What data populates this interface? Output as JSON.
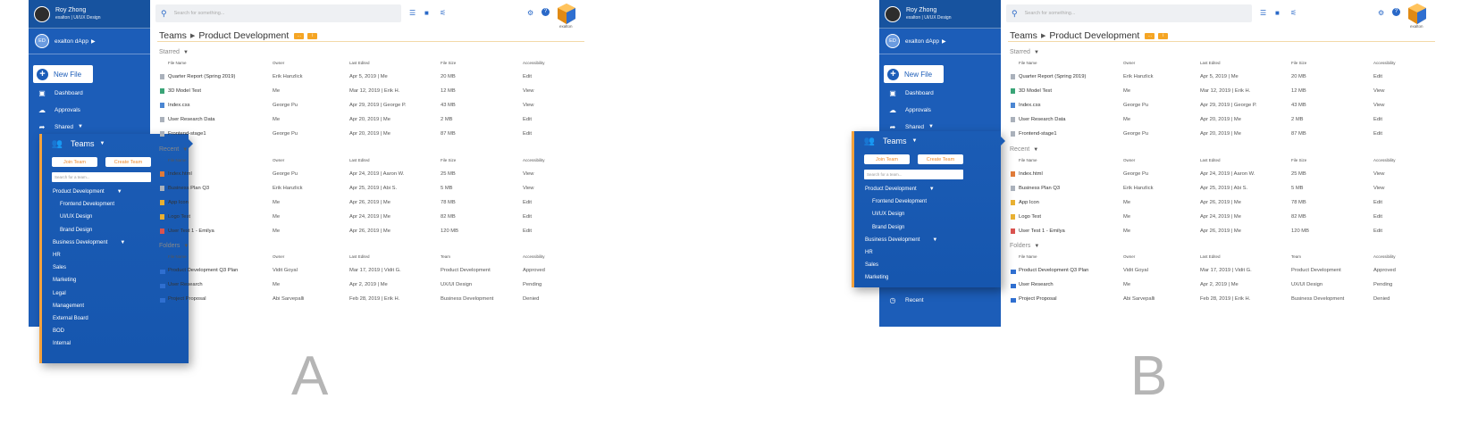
{
  "user": {
    "name": "Roy Zhong",
    "role": "exalton | UI/UX Design"
  },
  "org": {
    "initials": "ED",
    "name": "exalton dApp"
  },
  "new_file_label": "New File",
  "nav": [
    {
      "label": "Dashboard",
      "icon": "dashboard-icon"
    },
    {
      "label": "Approvals",
      "icon": "cloud-check-icon"
    },
    {
      "label": "Shared",
      "icon": "share-icon"
    }
  ],
  "recent_nav_label": "Recent",
  "search": {
    "placeholder": "Search for something..."
  },
  "logo_text": "exalton",
  "breadcrumb": {
    "root": "Teams",
    "current": "Product Development"
  },
  "teams_panel": {
    "title": "Teams",
    "join_label": "Join Team",
    "create_label": "Create Team",
    "search_placeholder": "Search for a team...",
    "items_a": [
      {
        "label": "Product Development",
        "level": 0,
        "dropdown": true
      },
      {
        "label": "Frontend Development",
        "level": 1
      },
      {
        "label": "UI/UX Design",
        "level": 1
      },
      {
        "label": "Brand Design",
        "level": 1
      },
      {
        "label": "Business Development",
        "level": 0,
        "dropdown": true
      },
      {
        "label": "HR",
        "level": 0
      },
      {
        "label": "Sales",
        "level": 0
      },
      {
        "label": "Marketing",
        "level": 0
      },
      {
        "label": "Legal",
        "level": 0
      },
      {
        "label": "Management",
        "level": 0
      },
      {
        "label": "External Board",
        "level": 0
      },
      {
        "label": "BOD",
        "level": 0
      },
      {
        "label": "Internal",
        "level": 0
      }
    ],
    "items_b": [
      {
        "label": "Product Development",
        "level": 0,
        "dropdown": true
      },
      {
        "label": "Frontend Development",
        "level": 1
      },
      {
        "label": "UI/UX Design",
        "level": 1
      },
      {
        "label": "Brand Design",
        "level": 1
      },
      {
        "label": "Business Development",
        "level": 0,
        "dropdown": true
      },
      {
        "label": "HR",
        "level": 0
      },
      {
        "label": "Sales",
        "level": 0
      },
      {
        "label": "Marketing",
        "level": 0
      }
    ]
  },
  "columns": {
    "name": "File Name",
    "owner": "Owner",
    "edited": "Last Edited",
    "size": "File Size",
    "access": "Accessibility",
    "team": "Team"
  },
  "starred": {
    "title": "Starred",
    "rows": [
      {
        "name": "Quarter Report (Spring 2019)",
        "owner": "Erik Hanzlick",
        "edited": "Apr 5, 2019 | Me",
        "size": "20 MB",
        "access": "Edit",
        "icon": "gray"
      },
      {
        "name": "3D Model Test",
        "owner": "Me",
        "edited": "Mar 12, 2019 | Erik H.",
        "size": "12 MB",
        "access": "View",
        "icon": "green"
      },
      {
        "name": "Index.css",
        "owner": "George Pu",
        "edited": "Apr 29, 2019 | George P.",
        "size": "43 MB",
        "access": "View",
        "icon": "blue"
      },
      {
        "name": "User Research Data",
        "owner": "Me",
        "edited": "Apr 20, 2019 | Me",
        "size": "2 MB",
        "access": "Edit",
        "icon": "gray"
      },
      {
        "name": "Frontend-stage1",
        "owner": "George Pu",
        "edited": "Apr 20, 2019 | Me",
        "size": "87 MB",
        "access": "Edit",
        "icon": "gray"
      }
    ]
  },
  "recent": {
    "title": "Recent",
    "rows": [
      {
        "name": "Index.html",
        "owner": "George Pu",
        "edited": "Apr 24, 2019 | Aaron W.",
        "size": "25 MB",
        "access": "View",
        "icon": "orange"
      },
      {
        "name": "Business Plan Q3",
        "owner": "Erik Hanzlick",
        "edited": "Apr 25, 2019 | Abi S.",
        "size": "5 MB",
        "access": "View",
        "icon": "gray"
      },
      {
        "name": "App Icon",
        "owner": "Me",
        "edited": "Apr 26, 2019 | Me",
        "size": "78 MB",
        "access": "Edit",
        "icon": "yellow"
      },
      {
        "name": "Logo Test",
        "owner": "Me",
        "edited": "Apr 24, 2019 | Me",
        "size": "82 MB",
        "access": "Edit",
        "icon": "yellow"
      },
      {
        "name": "User Test 1 - Emilya",
        "owner": "Me",
        "edited": "Apr 26, 2019 | Me",
        "size": "120 MB",
        "access": "Edit",
        "icon": "red"
      }
    ]
  },
  "folders": {
    "title": "Folders",
    "rows": [
      {
        "name": "Product Development Q3 Plan",
        "owner": "Vidit Goyal",
        "edited": "Mar 17, 2019 | Vidit G.",
        "team": "Product Development",
        "access": "Approved"
      },
      {
        "name": "User Research",
        "owner": "Me",
        "edited": "Apr 2, 2019 | Me",
        "team": "UX/UI Design",
        "access": "Pending"
      },
      {
        "name": "Project Proposal",
        "owner": "Abi Sarvepalli",
        "edited": "Feb 28, 2019 | Erik H.",
        "team": "Business Development",
        "access": "Denied"
      }
    ]
  },
  "labels": {
    "a": "A",
    "b": "B"
  },
  "colors": {
    "primary": "#1c5db8",
    "accent": "#f5a524"
  }
}
